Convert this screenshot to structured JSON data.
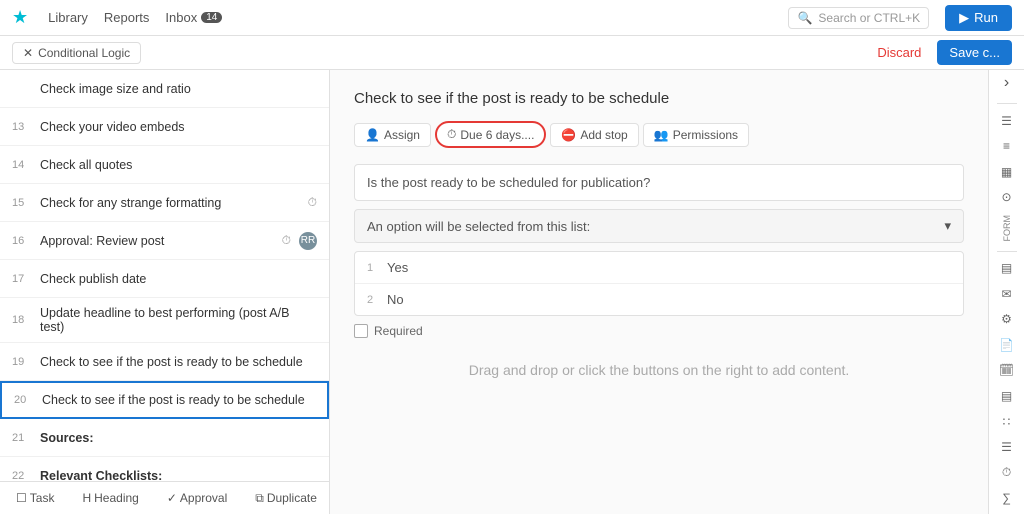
{
  "nav": {
    "logo": "★",
    "links": [
      "Library",
      "Reports",
      "Inbox"
    ],
    "inbox_count": "14",
    "search_placeholder": "Search or CTRL+K",
    "run_label": "Run"
  },
  "subnav": {
    "conditional_logic_label": "Conditional Logic",
    "discard_label": "Discard",
    "save_label": "Save c..."
  },
  "tasks": [
    {
      "num": "",
      "text": "Check image size and ratio",
      "icon": "",
      "badge": ""
    },
    {
      "num": "13",
      "text": "Check your video embeds",
      "icon": "",
      "badge": ""
    },
    {
      "num": "14",
      "text": "Check all quotes",
      "icon": "",
      "badge": ""
    },
    {
      "num": "15",
      "text": "Check for any strange formatting",
      "icon": "⏱",
      "badge": ""
    },
    {
      "num": "16",
      "text": "Approval: Review post",
      "icon": "⏱",
      "badge": "RR"
    },
    {
      "num": "17",
      "text": "Check publish date",
      "icon": "",
      "badge": ""
    },
    {
      "num": "18",
      "text": "Update headline to best performing (post A/B test)",
      "icon": "",
      "badge": ""
    },
    {
      "num": "19",
      "text": "Check to see if the post is ready to be schedule",
      "icon": "",
      "badge": ""
    },
    {
      "num": "20",
      "text": "Check to see if the post is ready to be schedule",
      "icon": "",
      "badge": "",
      "active": true
    },
    {
      "num": "21",
      "text": "Sources:",
      "icon": "",
      "badge": "",
      "bold": true
    },
    {
      "num": "22",
      "text": "Relevant Checklists:",
      "icon": "",
      "badge": "",
      "bold": true
    }
  ],
  "toolbar": {
    "task_label": "Task",
    "heading_label": "Heading",
    "approval_label": "Approval",
    "duplicate_label": "Duplicate"
  },
  "main": {
    "task_title": "Check to see if the post is ready to be schedule",
    "actions": {
      "assign_label": "Assign",
      "due_label": "Due 6 days....",
      "add_stop_label": "Add stop",
      "permissions_label": "Permissions"
    },
    "question": "Is the post ready to be scheduled for publication?",
    "select_placeholder": "An option will be selected from this list:",
    "options": [
      {
        "num": "1",
        "text": "Yes"
      },
      {
        "num": "2",
        "text": "No"
      }
    ],
    "required_label": "Required",
    "drag_drop_hint": "Drag and drop or click the buttons on the right to add content."
  },
  "right_panel": {
    "expand_icon": "›",
    "form_label": "FORM",
    "icons": [
      "☰",
      "≡",
      "▦",
      "⊙",
      "□",
      "✉",
      "⚙",
      "🗓",
      "▤",
      "∷",
      "☰",
      "⏱",
      "∑"
    ]
  }
}
